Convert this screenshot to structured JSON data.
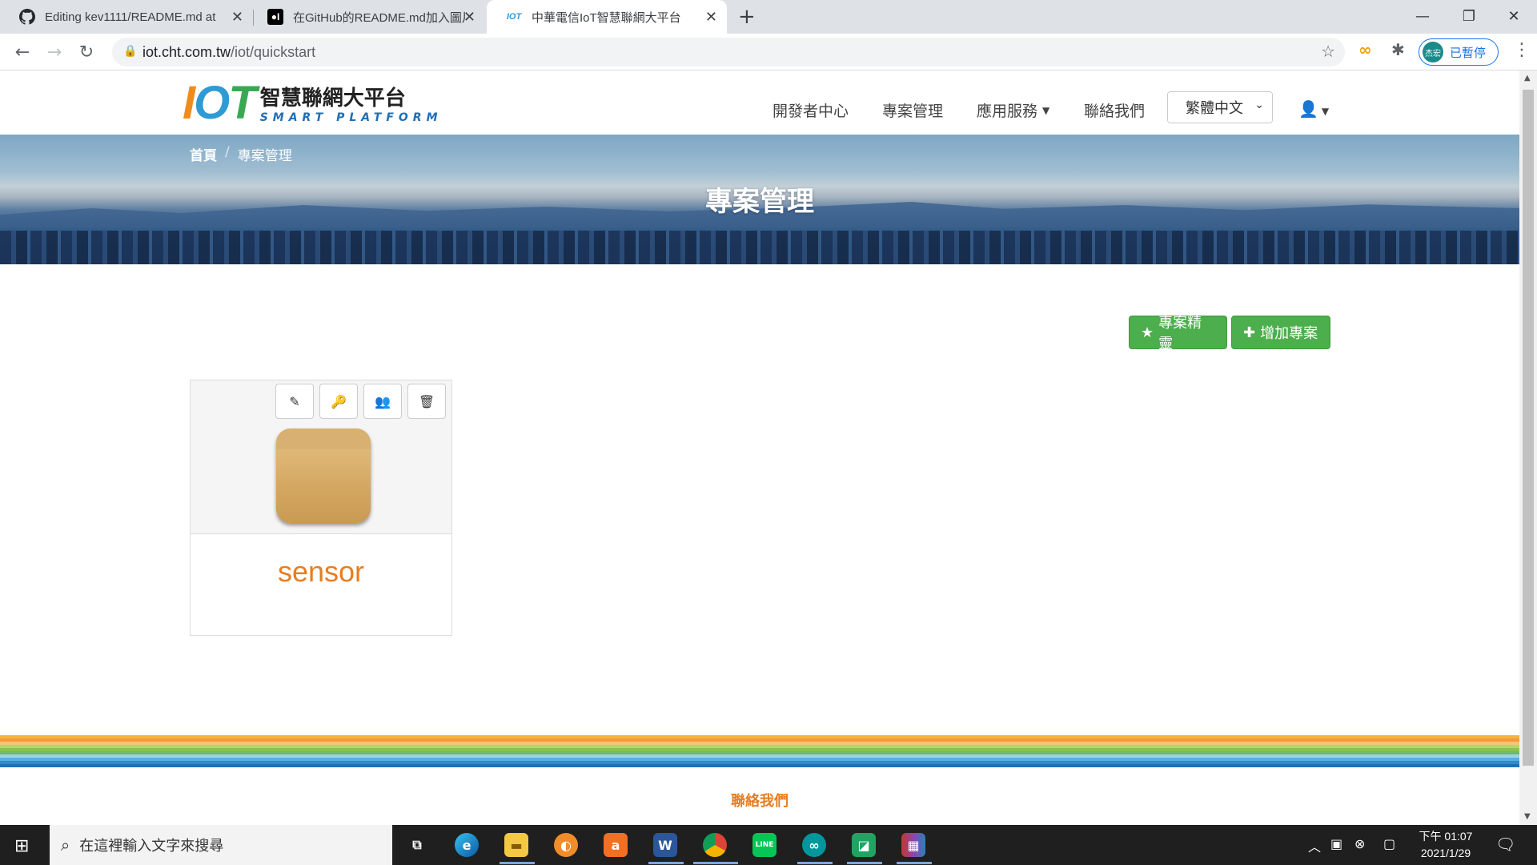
{
  "browser": {
    "tabs": [
      {
        "title": "Editing kev1111/README.md at",
        "favicon": "github-icon",
        "active": false
      },
      {
        "title": "在GitHub的README.md加入圖片",
        "favicon": "medium-icon",
        "active": false
      },
      {
        "title": "中華電信IoT智慧聯網大平台",
        "favicon": "iot-icon",
        "active": true
      }
    ],
    "url_host": "iot.cht.com.tw",
    "url_path": "/iot/quickstart",
    "profile_avatar": "杰宏",
    "profile_label": "已暫停"
  },
  "site": {
    "logo_iot": "IOT",
    "logo_cn": "智慧聯網大平台",
    "logo_en": "SMART PLATFORM",
    "nav": [
      "開發者中心",
      "專案管理",
      "應用服務",
      "聯絡我們"
    ],
    "language": "繁體中文",
    "breadcrumb": {
      "home": "首頁",
      "separator": "/",
      "current": "專案管理"
    },
    "page_title": "專案管理",
    "buttons": {
      "wizard": "專案精靈",
      "add_project": "增加專案"
    },
    "project": {
      "name": "sensor"
    },
    "footer_contact": "聯絡我們",
    "colors": {
      "green": "#4cae4c",
      "orange": "#e67e22"
    }
  },
  "taskbar": {
    "search_placeholder": "在這裡輸入文字來搜尋",
    "time_period": "下午 01:07",
    "date": "2021/1/29"
  }
}
